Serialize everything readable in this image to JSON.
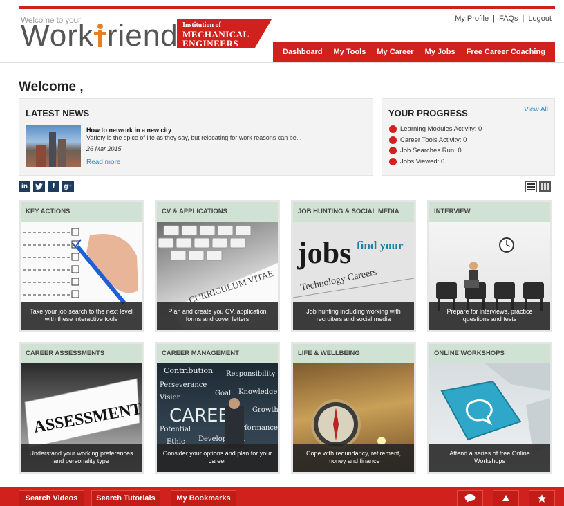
{
  "brand": {
    "welcome_small": "Welcome to your",
    "logo_text_pre": "Work",
    "logo_text_post": "riend",
    "partner_line1": "Institution of",
    "partner_line2": "MECHANICAL",
    "partner_line3": "ENGINEERS"
  },
  "toplinks": [
    "My Profile",
    "FAQs",
    "Logout"
  ],
  "nav": [
    "Dashboard",
    "My Tools",
    "My Career",
    "My Jobs",
    "Free Career Coaching"
  ],
  "welcome": "Welcome ,",
  "news": {
    "title": "LATEST NEWS",
    "headline": "How to network in a new city",
    "summary": "Variety is the spice of life as they say, but relocating for work reasons can be...",
    "date": "26 Mar 2015",
    "more": "Read more"
  },
  "progress": {
    "title": "YOUR PROGRESS",
    "view_all": "View All",
    "items": [
      "Learning Modules Activity: 0",
      "Career Tools Activity: 0",
      "Job Searches Run: 0",
      "Jobs Viewed: 0"
    ]
  },
  "social": [
    "in",
    "t",
    "f",
    "g+"
  ],
  "tiles": [
    {
      "title": "KEY ACTIONS",
      "caption": "Take your job search to the next level with these interactive tools"
    },
    {
      "title": "CV & APPLICATIONS",
      "caption": "Plan and create you CV, application forms and cover letters",
      "image_text": "CURRICULUM VITAE"
    },
    {
      "title": "JOB HUNTING & SOCIAL MEDIA",
      "caption": "Job hunting including working with recruiters and social media",
      "image_text": "jobs",
      "image_text2": "find your",
      "image_text3": "Technology Careers"
    },
    {
      "title": "INTERVIEW",
      "caption": "Prepare for interviews, practice questions and tests"
    },
    {
      "title": "CAREER ASSESSMENTS",
      "caption": "Understand your working preferences and personality type",
      "image_text": "ASSESSMENT"
    },
    {
      "title": "CAREER MANAGEMENT",
      "caption": "Consider your options and plan for your career",
      "image_words": [
        "Contribution",
        "Responsibility",
        "Perseverance",
        "Goal",
        "Knowledge",
        "Vision",
        "CAREER",
        "Growth",
        "Potential",
        "Performance",
        "Ethic",
        "Development"
      ]
    },
    {
      "title": "LIFE & WELLBEING",
      "caption": "Cope with redundancy, retirement, money and finance"
    },
    {
      "title": "ONLINE WORKSHOPS",
      "caption": "Attend a series of free Online Workshops"
    }
  ],
  "footer": [
    "Search Videos",
    "Search Tutorials",
    "My Bookmarks"
  ],
  "colors": {
    "brand_red": "#d0211c",
    "tile_header": "#cfe2d4",
    "link_blue": "#2a8bd0"
  },
  "icons": {
    "footer_right": [
      "chat-icon",
      "bell-icon",
      "star-icon"
    ],
    "view_toggle": [
      "list-view-icon",
      "grid-view-icon"
    ]
  }
}
